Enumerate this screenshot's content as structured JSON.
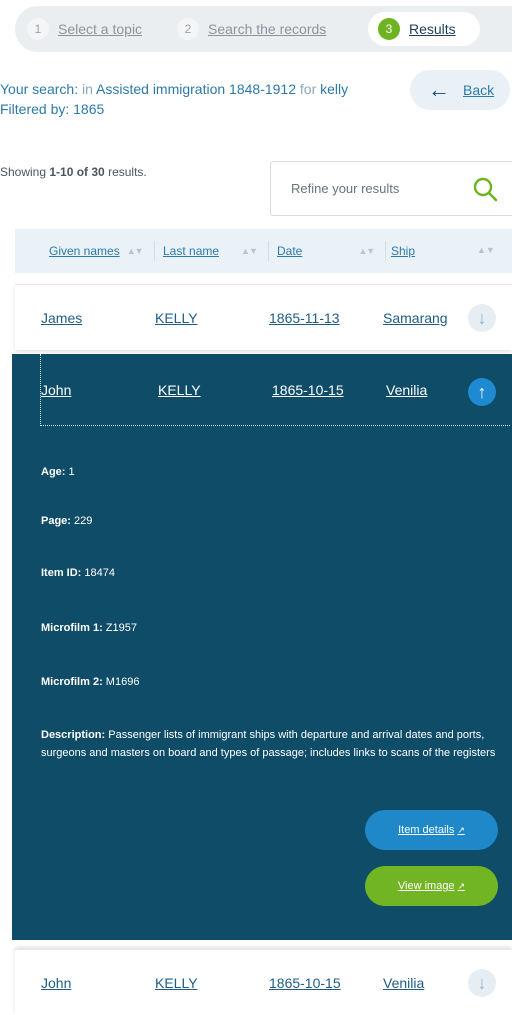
{
  "steps": [
    {
      "num": "1",
      "label": "Select a topic"
    },
    {
      "num": "2",
      "label": "Search the records"
    },
    {
      "num": "3",
      "label": "Results"
    }
  ],
  "summary": {
    "prefix": "Your search:",
    "in_word": "in",
    "collection": "Assisted immigration 1848-1912",
    "for_word": "for",
    "term": "kelly",
    "filter_label": "Filtered by:",
    "filter_value": "1865"
  },
  "back_label": "Back",
  "showing": {
    "prefix": "Showing",
    "range": "1-10 of 30",
    "suffix": "results."
  },
  "refine": {
    "placeholder": "Refine your results"
  },
  "columns": [
    "Given names",
    "Last name",
    "Date",
    "Ship"
  ],
  "rows": [
    {
      "given": "James",
      "last": "KELLY",
      "date": "1865-11-13",
      "ship": "Samarang"
    },
    {
      "given": "John",
      "last": "KELLY",
      "date": "1865-10-15",
      "ship": "Venilia"
    },
    {
      "given": "John",
      "last": "KELLY",
      "date": "1865-10-15",
      "ship": "Venilia"
    }
  ],
  "expanded": {
    "age_label": "Age:",
    "age": "1",
    "page_label": "Page:",
    "page": "229",
    "item_label": "Item ID:",
    "item": "18474",
    "mf1_label": "Microfilm 1:",
    "mf1": "Z1957",
    "mf2_label": "Microfilm 2:",
    "mf2": "M1696",
    "desc_label": "Description:",
    "desc": "Passenger lists of immigrant ships with departure and arrival dates and ports, surgeons and masters on board and types of passage; includes links to scans of the registers",
    "item_details_label": "Item details",
    "view_image_label": "View image"
  },
  "colors": {
    "accent": "#0f4c68",
    "link": "#1f5d86",
    "green": "#72b524",
    "blue_button": "#1e88c8"
  }
}
